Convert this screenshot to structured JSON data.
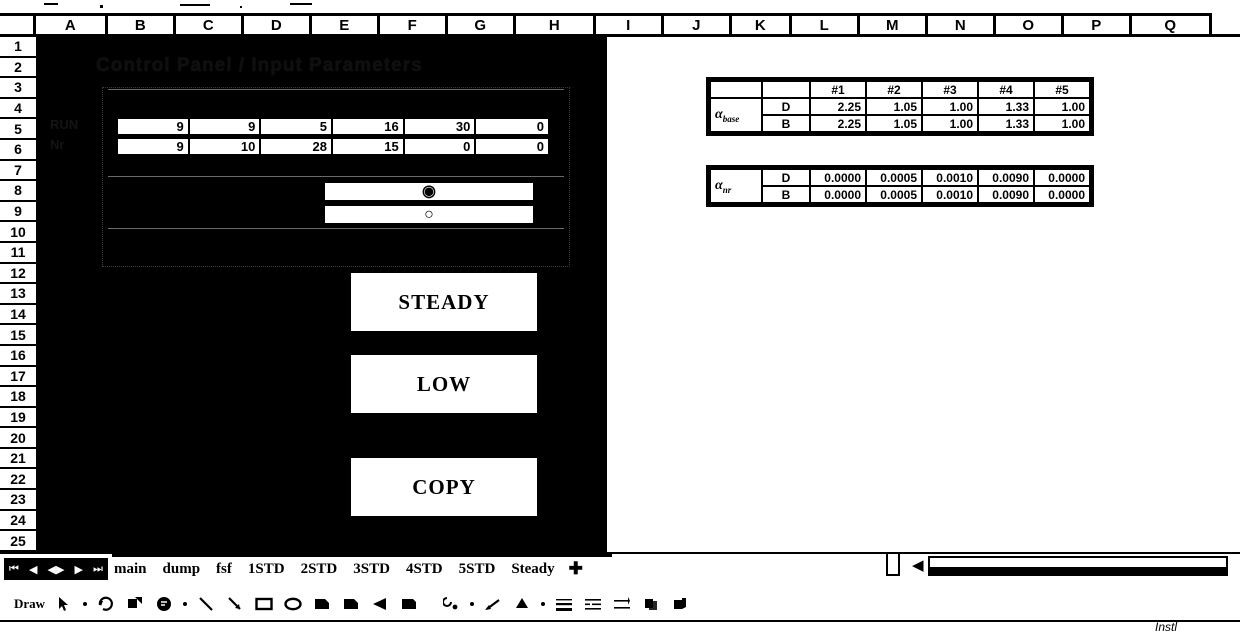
{
  "window": {
    "app": "Spreadsheet",
    "sheet_title": "Control Panel / Input Parameters"
  },
  "grid": {
    "column_headers": [
      "A",
      "B",
      "C",
      "D",
      "E",
      "F",
      "G",
      "H",
      "I",
      "J",
      "K",
      "L",
      "M",
      "N",
      "O",
      "P",
      "Q"
    ],
    "row_headers": [
      "1",
      "2",
      "3",
      "4",
      "5",
      "6",
      "7",
      "8",
      "9",
      "10",
      "11",
      "12",
      "13",
      "14",
      "15",
      "16",
      "17",
      "18",
      "19",
      "20",
      "21",
      "22",
      "23",
      "24",
      "25"
    ]
  },
  "input_panel": {
    "row5": {
      "label": "RUN",
      "values": [
        "9",
        "9",
        "5",
        "16",
        "30",
        "0"
      ]
    },
    "row6": {
      "label": "Nr",
      "values": [
        "9",
        "10",
        "28",
        "15",
        "0",
        "0"
      ]
    },
    "options": [
      {
        "glyph": "◉",
        "selected": true
      },
      {
        "glyph": "○",
        "selected": false
      }
    ]
  },
  "buttons": [
    {
      "label": "STEADY",
      "name": "steady-button"
    },
    {
      "label": "LOW",
      "name": "low-button"
    },
    {
      "label": "COPY",
      "name": "copy-button"
    }
  ],
  "tables": [
    {
      "name": "alpha-base-table",
      "greek": "α",
      "subscript": "base",
      "column_headers": [
        "#1",
        "#2",
        "#3",
        "#4",
        "#5"
      ],
      "rows": [
        {
          "label": "D",
          "values": [
            "2.25",
            "1.05",
            "1.00",
            "1.33",
            "1.00"
          ]
        },
        {
          "label": "B",
          "values": [
            "2.25",
            "1.05",
            "1.00",
            "1.33",
            "1.00"
          ]
        }
      ]
    },
    {
      "name": "alpha-nr-table",
      "greek": "α",
      "subscript": "nr",
      "column_headers": [
        "",
        "",
        "",
        "",
        ""
      ],
      "rows": [
        {
          "label": "D",
          "values": [
            "0.0000",
            "0.0005",
            "0.0010",
            "0.0090",
            "0.0000"
          ]
        },
        {
          "label": "B",
          "values": [
            "0.0000",
            "0.0005",
            "0.0010",
            "0.0090",
            "0.0000"
          ]
        }
      ]
    }
  ],
  "sheet_tabs": {
    "items": [
      "main",
      "dump",
      "fsf",
      "1STD",
      "2STD",
      "3STD",
      "4STD",
      "5STD",
      "Steady"
    ],
    "add_glyph": "✚",
    "nav": [
      "⏮",
      "◀",
      "◀▶",
      "▶",
      "⏭"
    ]
  },
  "scrollbar": {
    "left_arrow": "◀"
  },
  "drawing_toolbar": {
    "label": "Draw",
    "tools": [
      "select-arrow-icon",
      "rotate-icon",
      "autoshapes-icon",
      "line-icon",
      "arrow-icon",
      "rectangle-icon",
      "oval-icon",
      "textbox-icon",
      "wordart-icon",
      "filled-triangle-icon",
      "insert-picture-icon",
      "fill-color-icon",
      "line-color-icon",
      "font-color-icon",
      "line-style-icon",
      "dash-style-icon",
      "arrow-style-icon",
      "shadow-icon",
      "three-d-icon"
    ]
  },
  "status": "Instl"
}
